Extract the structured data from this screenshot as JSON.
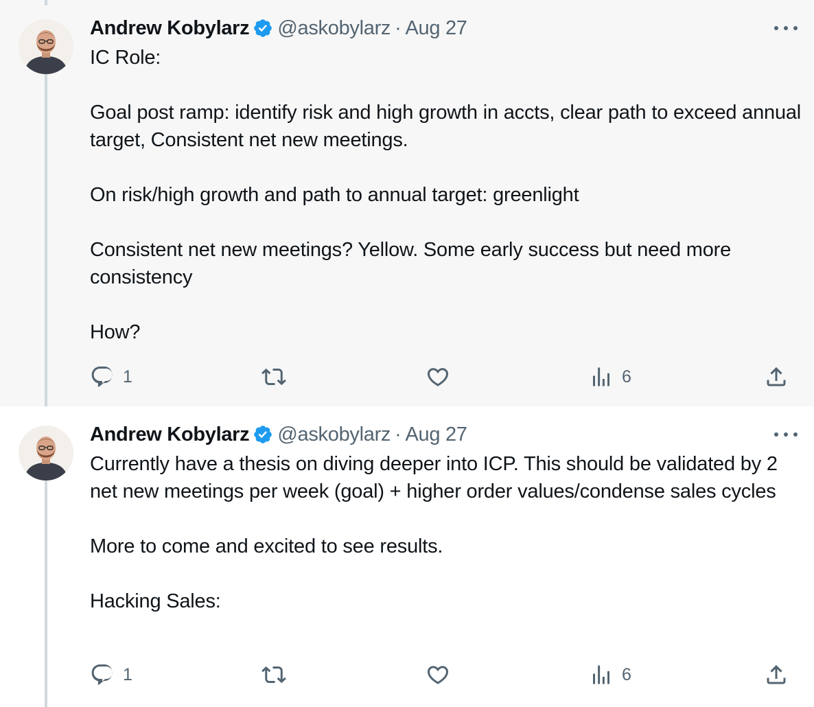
{
  "tweets": [
    {
      "author_name": "Andrew Kobylarz",
      "handle": "@askobylarz",
      "separator": "·",
      "date": "Aug 27",
      "paragraphs": [
        "IC Role:",
        "Goal post ramp: identify risk and high growth in accts, clear path to exceed annual target, Consistent net new meetings.",
        "On risk/high growth and path to annual target: greenlight",
        "Consistent net new meetings? Yellow. Some early success but need more consistency",
        "How?"
      ],
      "reply_count": "1",
      "views_count": "6"
    },
    {
      "author_name": "Andrew Kobylarz",
      "handle": "@askobylarz",
      "separator": "·",
      "date": "Aug 27",
      "paragraphs": [
        "Currently have a thesis on diving deeper into ICP. This should be validated by 2 net new meetings per week (goal) + higher order values/condense sales cycles",
        "More to come and excited to see results.",
        "Hacking Sales:"
      ],
      "reply_count": "1",
      "views_count": "6"
    }
  ],
  "icons": {
    "verified": "verified-badge-icon",
    "more": "more-horizontal-icon",
    "reply": "reply-icon",
    "retweet": "retweet-icon",
    "like": "heart-icon",
    "views": "views-chart-icon",
    "share": "share-icon"
  },
  "colors": {
    "verified_blue": "#1d9bf0",
    "secondary_text": "#536471",
    "primary_text": "#0f1419",
    "thread_line": "#cfd9de",
    "highlight_background": "#f7f7f7"
  }
}
